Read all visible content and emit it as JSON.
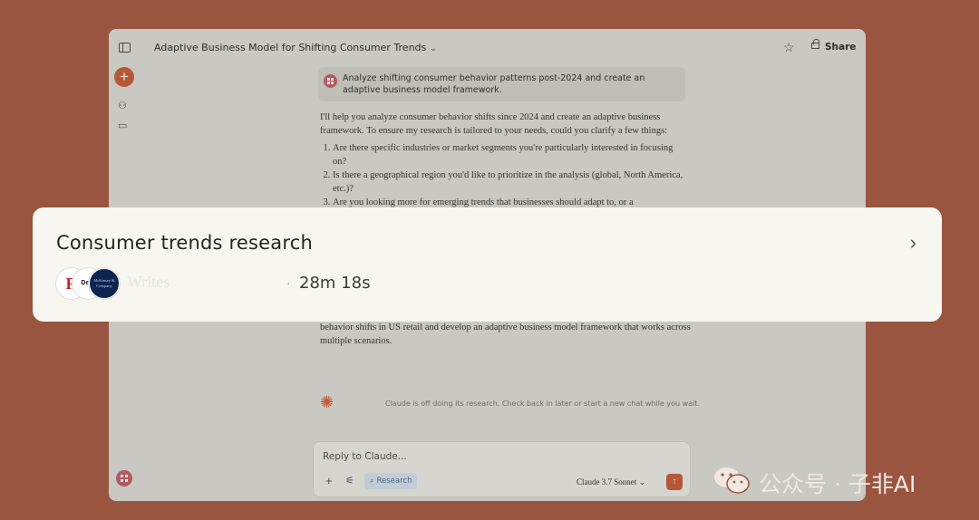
{
  "window": {
    "conversation_title": "Adaptive Business Model for Shifting Consumer Trends",
    "share_label": "Share"
  },
  "prompt": {
    "text": "Analyze shifting consumer behavior patterns post-2024 and create an adaptive business model framework."
  },
  "reply": {
    "intro": "I'll help you analyze consumer behavior shifts since 2024 and create an adaptive business framework. To ensure my research is tailored to your needs, could you clarify a few things:",
    "questions": [
      "Are there specific industries or market segments you're particularly interested in focusing on?",
      "Is there a geographical region you'd like to prioritize in the analysis (global, North America, etc.)?",
      "Are you looking more for emerging trends that businesses should adapt to, or a"
    ],
    "continued": "behavior shifts in US retail and develop an adaptive business model framework that works across multiple scenarios."
  },
  "status": {
    "text": "Claude is off doing its research. Check back in later or start a new chat while you wait."
  },
  "composer": {
    "placeholder": "Reply to Claude...",
    "research_label": "Research",
    "model_label": "Claude 3.7 Sonnet"
  },
  "card": {
    "title": "Consumer trends research",
    "logo_b_text": "Delo",
    "logo_c_text": "McKinsey & Company",
    "faded_source": "Writes",
    "duration": "28m 18s"
  },
  "watermark": {
    "text": "公众号 · 子非AI"
  }
}
